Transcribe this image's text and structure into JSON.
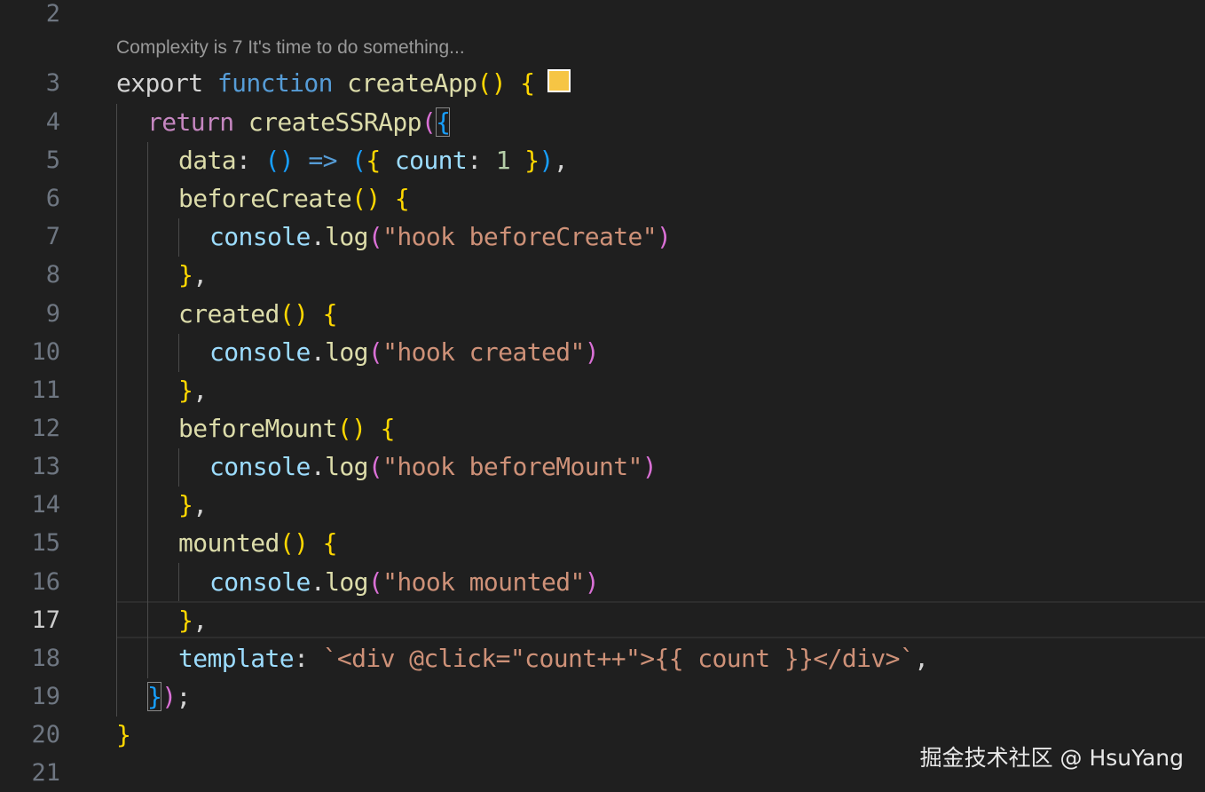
{
  "editor": {
    "codelens": "Complexity is 7 It's time to do something...",
    "swatch_color": "#f6c544",
    "active_line": "17",
    "lines": [
      {
        "num": "2"
      },
      {
        "num": "3",
        "t": [
          "export",
          " ",
          "function",
          " ",
          "createApp",
          "()",
          " ",
          "{"
        ]
      },
      {
        "num": "4",
        "t": [
          "return",
          " ",
          "createSSRApp",
          "(",
          "{"
        ]
      },
      {
        "num": "5",
        "t": [
          "data",
          ": ",
          "()",
          " ",
          "=>",
          " ",
          "(",
          "{",
          " ",
          "count",
          ": ",
          "1",
          " ",
          "}",
          ")",
          ","
        ]
      },
      {
        "num": "6",
        "t": [
          "beforeCreate",
          "()",
          " ",
          "{"
        ]
      },
      {
        "num": "7",
        "t": [
          "console",
          ".",
          "log",
          "(",
          "\"hook beforeCreate\"",
          ")"
        ]
      },
      {
        "num": "8",
        "t": [
          "}",
          ","
        ]
      },
      {
        "num": "9",
        "t": [
          "created",
          "()",
          " ",
          "{"
        ]
      },
      {
        "num": "10",
        "t": [
          "console",
          ".",
          "log",
          "(",
          "\"hook created\"",
          ")"
        ]
      },
      {
        "num": "11",
        "t": [
          "}",
          ","
        ]
      },
      {
        "num": "12",
        "t": [
          "beforeMount",
          "()",
          " ",
          "{"
        ]
      },
      {
        "num": "13",
        "t": [
          "console",
          ".",
          "log",
          "(",
          "\"hook beforeMount\"",
          ")"
        ]
      },
      {
        "num": "14",
        "t": [
          "}",
          ","
        ]
      },
      {
        "num": "15",
        "t": [
          "mounted",
          "()",
          " ",
          "{"
        ]
      },
      {
        "num": "16",
        "t": [
          "console",
          ".",
          "log",
          "(",
          "\"hook mounted\"",
          ")"
        ]
      },
      {
        "num": "17",
        "t": [
          "}",
          ","
        ]
      },
      {
        "num": "18",
        "t": [
          "template",
          ": ",
          "`<div @click=\"count++\">{{ count }}</div>`",
          ","
        ]
      },
      {
        "num": "19",
        "t": [
          "}",
          ")",
          ";"
        ]
      },
      {
        "num": "20",
        "t": [
          "}"
        ]
      },
      {
        "num": "21"
      }
    ]
  },
  "watermark": "掘金技术社区 @ HsuYang"
}
